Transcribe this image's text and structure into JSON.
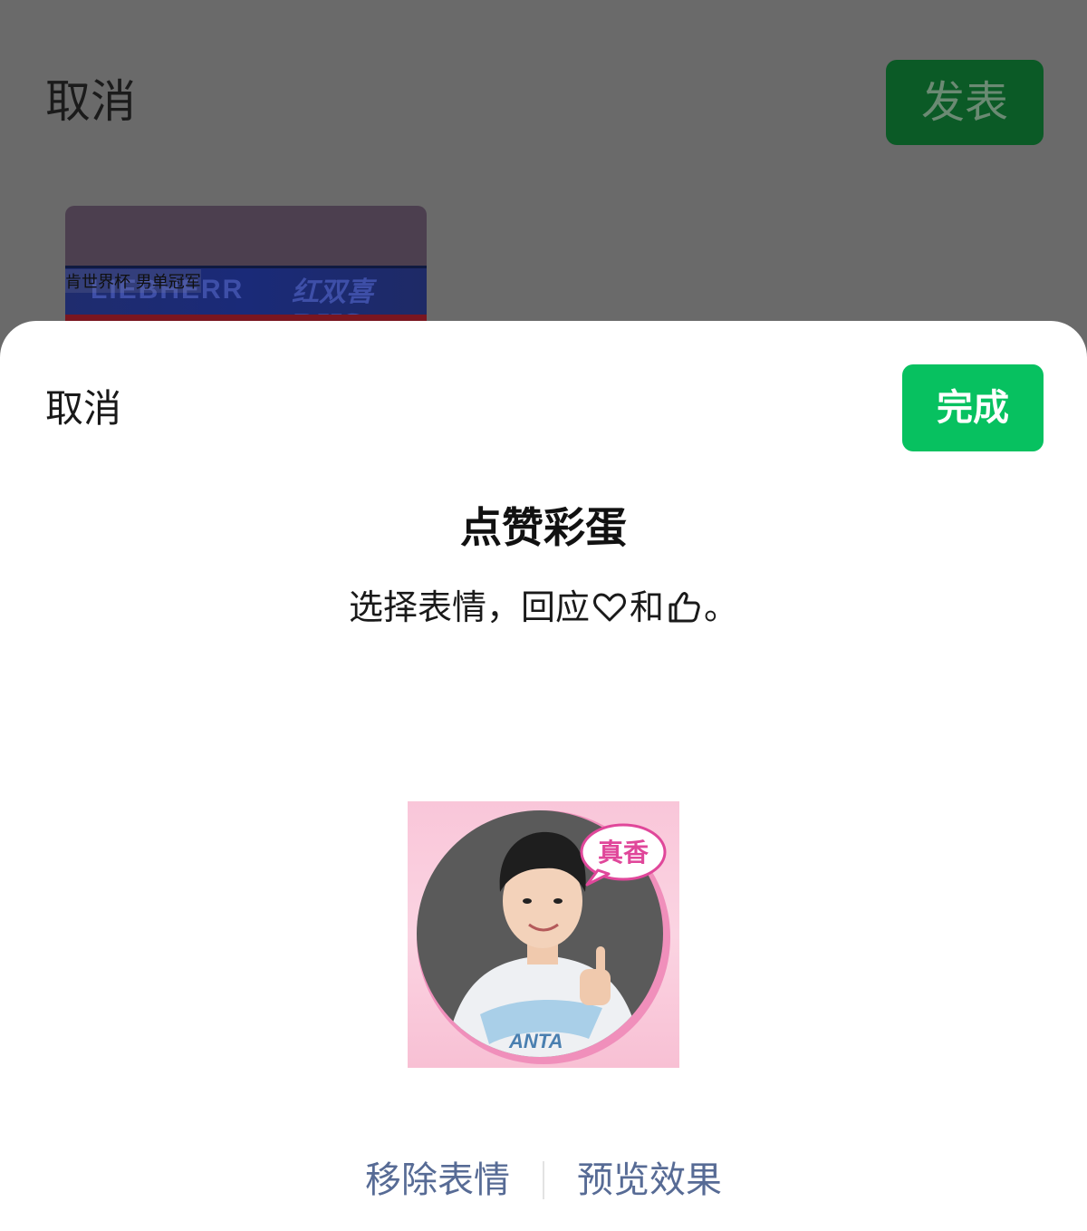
{
  "compose": {
    "cancel_label": "取消",
    "publish_label": "发表",
    "thumbnail": {
      "caption": "肯世界杯 男单冠军",
      "band_text": "LIEBHERR",
      "band_logo": "红双喜 DHS"
    }
  },
  "sheet": {
    "cancel_label": "取消",
    "done_label": "完成",
    "title": "点赞彩蛋",
    "subtitle_before": "选择表情，回应",
    "subtitle_middle": "和",
    "subtitle_after": "。",
    "icons": [
      "heart-outline-icon",
      "thumbs-up-outline-icon"
    ],
    "sticker": {
      "bubble_text": "真香",
      "shirt_text": "ANTA"
    },
    "actions": {
      "remove_label": "移除表情",
      "preview_label": "预览效果"
    }
  },
  "colors": {
    "accent_green": "#07c160",
    "dim_green": "#0b5a26",
    "link_blue": "#576b95"
  }
}
